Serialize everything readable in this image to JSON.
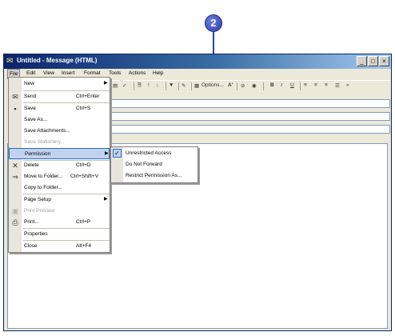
{
  "callout": {
    "number": "2"
  },
  "window": {
    "title": "Untitled - Message (HTML)",
    "controls": {
      "minimize": "_",
      "maximize": "□",
      "close": "×"
    }
  },
  "menubar": [
    "File",
    "Edit",
    "View",
    "Insert",
    "Format",
    "Tools",
    "Actions",
    "Help"
  ],
  "toolbar": {
    "options_label": "Options...",
    "font_size_glyph": "A'"
  },
  "file_menu": {
    "items": [
      {
        "label": "New",
        "shortcut": "",
        "submenu": true
      },
      {
        "label": "Send",
        "shortcut": "Ctrl+Enter"
      },
      {
        "label": "Save",
        "shortcut": "Ctrl+S"
      },
      {
        "label": "Save As..."
      },
      {
        "label": "Save Attachments..."
      },
      {
        "label": "Save Stationery...",
        "disabled": true
      },
      {
        "label": "Permission",
        "submenu": true
      },
      {
        "label": "Delete",
        "shortcut": "Ctrl+D"
      },
      {
        "label": "Move to Folder...",
        "shortcut": "Ctrl+Shift+V"
      },
      {
        "label": "Copy to Folder..."
      },
      {
        "label": "Page Setup",
        "submenu": true
      },
      {
        "label": "Print Preview",
        "disabled": true
      },
      {
        "label": "Print...",
        "shortcut": "Ctrl+P"
      },
      {
        "label": "Properties"
      },
      {
        "label": "Close",
        "shortcut": "Alt+F4"
      }
    ]
  },
  "permission_submenu": {
    "items": [
      {
        "label": "Unrestricted Access",
        "checked": true
      },
      {
        "label": "Do Not Forward"
      },
      {
        "label": "Restrict Permission As..."
      }
    ]
  }
}
